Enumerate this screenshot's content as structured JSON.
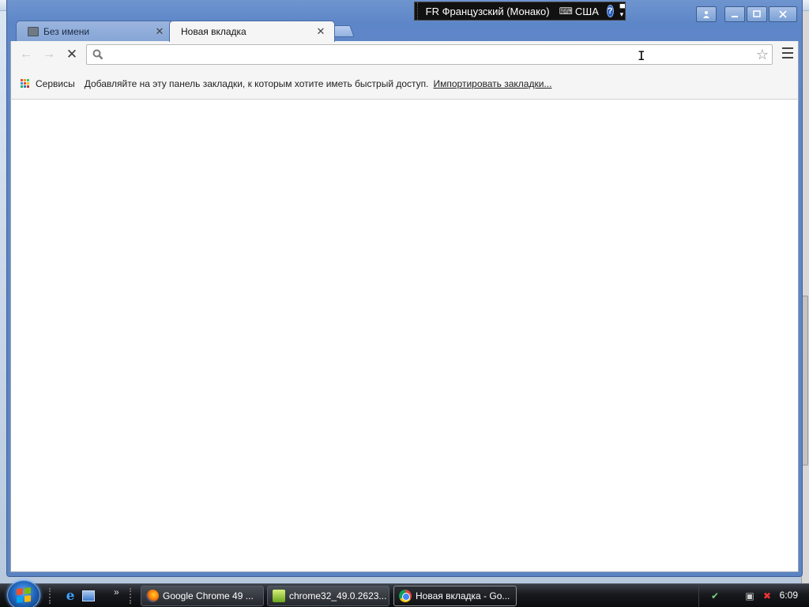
{
  "language_bar": {
    "language": "FR Французский (Монако)",
    "keyboard": "США",
    "help_glyph": "?"
  },
  "tabs": [
    {
      "title": "Без имени",
      "active": false,
      "close_glyph": "✕"
    },
    {
      "title": "Новая вкладка",
      "active": true,
      "close_glyph": "✕"
    }
  ],
  "toolbar": {
    "omnibox_value": "",
    "back_glyph": "←",
    "forward_glyph": "→",
    "stop_glyph": "✕",
    "star_glyph": "☆"
  },
  "bookmarks_bar": {
    "apps_label": "Сервисы",
    "hint": "Добавляйте на эту панель закладки, к которым хотите иметь быстрый доступ.",
    "import_link": "Импортировать закладки..."
  },
  "taskbar": {
    "items": [
      {
        "label": "Google Chrome 49 ...",
        "icon": "firefox-icon"
      },
      {
        "label": "chrome32_49.0.2623...",
        "icon": "archive-icon"
      },
      {
        "label": "Новая вкладка - Go...",
        "icon": "chrome-icon",
        "active": true
      }
    ],
    "clock": "6:09"
  },
  "colors": {
    "window_frame": "#5d86c8",
    "page_bg": "#ffffff",
    "taskbar": "#17191d"
  }
}
